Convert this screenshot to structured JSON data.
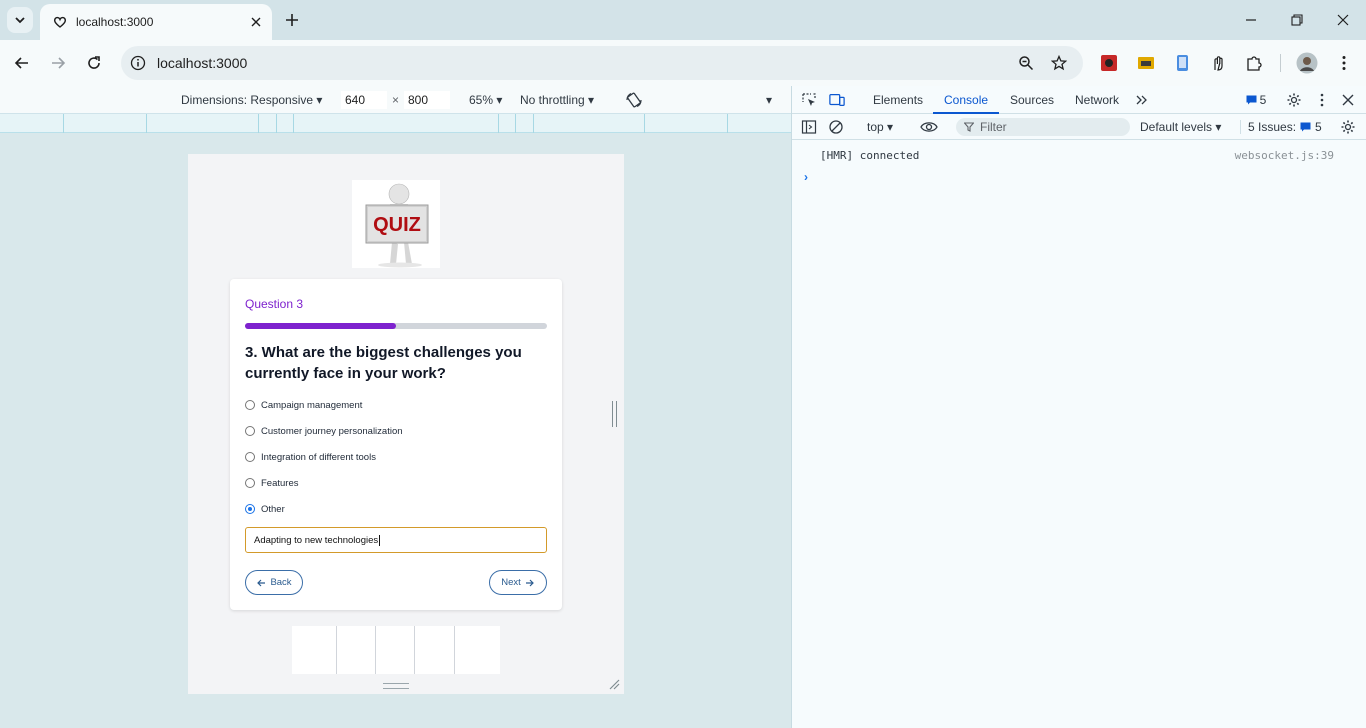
{
  "browser": {
    "tab_title": "localhost:3000",
    "url": "localhost:3000"
  },
  "device_toolbar": {
    "dimensions_label": "Dimensions: Responsive",
    "width": "640",
    "times": "×",
    "height": "800",
    "zoom": "65%",
    "throttling": "No throttling"
  },
  "quiz": {
    "image_text": "QUIZ",
    "question_label": "Question 3",
    "progress_fraction": 0.5,
    "question_title": "3. What are the biggest challenges you currently face in your work?",
    "options": [
      {
        "label": "Campaign management",
        "selected": false
      },
      {
        "label": "Customer journey personalization",
        "selected": false
      },
      {
        "label": "Integration of different tools",
        "selected": false
      },
      {
        "label": "Features",
        "selected": false
      },
      {
        "label": "Other",
        "selected": true
      }
    ],
    "other_value": "Adapting to new technologies",
    "back_label": "Back",
    "next_label": "Next"
  },
  "devtools": {
    "tabs": [
      "Elements",
      "Console",
      "Sources",
      "Network"
    ],
    "active_tab": "Console",
    "messages_count": "5",
    "context": "top",
    "filter_placeholder": "Filter",
    "levels": "Default levels",
    "issues_label": "5 Issues:",
    "issues_count": "5",
    "console_message": "[HMR] connected",
    "console_source": "websocket.js:39"
  }
}
